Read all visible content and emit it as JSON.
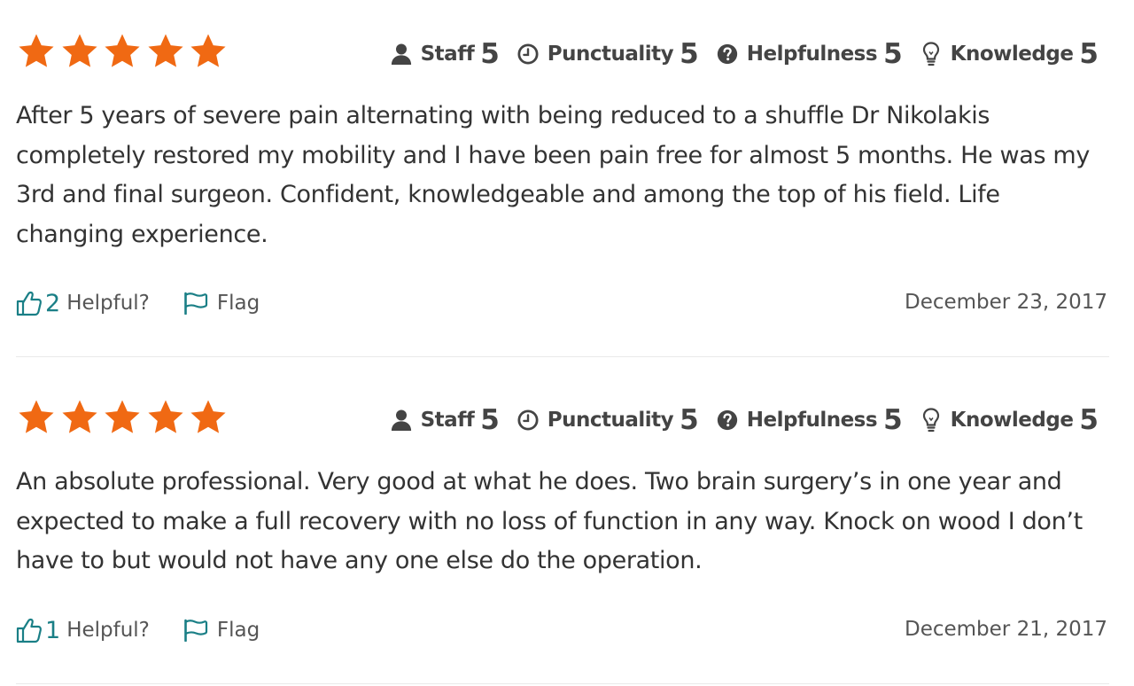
{
  "colors": {
    "star": "#f06913",
    "accent": "#1a7f86",
    "text": "#333333",
    "muted": "#555555"
  },
  "reviews": [
    {
      "rating": 5,
      "metrics": [
        {
          "icon": "person-icon",
          "label": "Staff",
          "value": "5"
        },
        {
          "icon": "clock-icon",
          "label": "Punctuality",
          "value": "5"
        },
        {
          "icon": "question-icon",
          "label": "Helpfulness",
          "value": "5"
        },
        {
          "icon": "lightbulb-icon",
          "label": "Knowledge",
          "value": "5"
        }
      ],
      "text": "After 5 years of severe pain alternating with being reduced to a shuffle Dr Nikolakis completely restored my mobility and I have been pain free for almost 5 months. He was my 3rd and final surgeon. Confident, knowledgeable and among the top of his field. Life changing experience.",
      "helpful_count": "2",
      "helpful_label": "Helpful?",
      "flag_label": "Flag",
      "date": "December 23, 2017"
    },
    {
      "rating": 5,
      "metrics": [
        {
          "icon": "person-icon",
          "label": "Staff",
          "value": "5"
        },
        {
          "icon": "clock-icon",
          "label": "Punctuality",
          "value": "5"
        },
        {
          "icon": "question-icon",
          "label": "Helpfulness",
          "value": "5"
        },
        {
          "icon": "lightbulb-icon",
          "label": "Knowledge",
          "value": "5"
        }
      ],
      "text": "An absolute professional. Very good at what he does. Two brain surgery’s in one year and expected to make a full recovery with no loss of function in any way. Knock on wood I don’t have to but would not have any one else do the operation.",
      "helpful_count": "1",
      "helpful_label": "Helpful?",
      "flag_label": "Flag",
      "date": "December 21, 2017"
    }
  ]
}
